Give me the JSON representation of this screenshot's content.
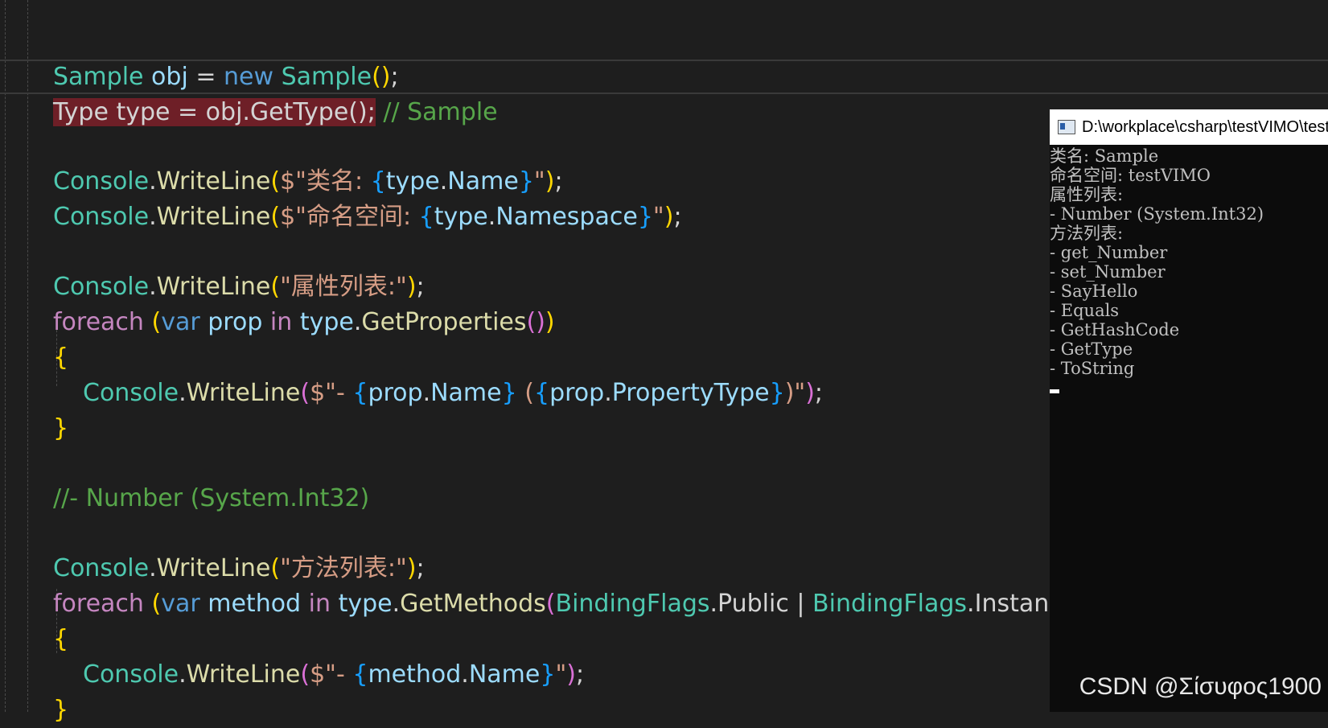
{
  "editor": {
    "code": {
      "l1": {
        "a": "Sample",
        "b": " ",
        "c": "obj",
        "d": " = ",
        "e": "new",
        "f": " ",
        "g": "Sample",
        "h": "(",
        "i": ")",
        "j": ";"
      },
      "l2": {
        "a": "Type",
        "b": " type = obj.GetType();",
        "c": " ",
        "d": "// Sample"
      },
      "l3": {
        "a": "Console",
        "b": ".",
        "c": "WriteLine",
        "d": "(",
        "e": "$\"类名: ",
        "f": "{",
        "g": "type",
        "h": ".",
        "i": "Name",
        "j": "}",
        "k": "\"",
        "l": ")",
        "m": ";"
      },
      "l4": {
        "a": "Console",
        "b": ".",
        "c": "WriteLine",
        "d": "(",
        "e": "$\"命名空间: ",
        "f": "{",
        "g": "type",
        "h": ".",
        "i": "Namespace",
        "j": "}",
        "k": "\"",
        "l": ")",
        "m": ";"
      },
      "l5": {
        "a": "Console",
        "b": ".",
        "c": "WriteLine",
        "d": "(",
        "e": "\"属性列表:\"",
        "f": ")",
        "g": ";"
      },
      "l6": {
        "a": "foreach",
        "b": " ",
        "c": "(",
        "d": "var",
        "e": " ",
        "f": "prop",
        "g": " ",
        "h": "in",
        "i": " ",
        "j": "type",
        "k": ".",
        "l": "GetProperties",
        "m": "()",
        "n": ")"
      },
      "l7": {
        "a": "{"
      },
      "l8": {
        "a": "Console",
        "b": ".",
        "c": "WriteLine",
        "d": "(",
        "e": "$\"- ",
        "f": "{",
        "g": "prop",
        "h": ".",
        "i": "Name",
        "j": "}",
        "k": " (",
        "l": "{",
        "m": "prop",
        "n": ".",
        "o": "PropertyType",
        "p": "}",
        "q": ")\"",
        "r": ")",
        "s": ";"
      },
      "l9": {
        "a": "}"
      },
      "l10": {
        "a": "//- Number (System.Int32)"
      },
      "l11": {
        "a": "Console",
        "b": ".",
        "c": "WriteLine",
        "d": "(",
        "e": "\"方法列表:\"",
        "f": ")",
        "g": ";"
      },
      "l12": {
        "a": "foreach",
        "b": " ",
        "c": "(",
        "d": "var",
        "e": " ",
        "f": "method",
        "g": " ",
        "h": "in",
        "i": " ",
        "j": "type",
        "k": ".",
        "l": "GetMethods",
        "m": "(",
        "n": "BindingFlags",
        "o": ".",
        "p": "Public",
        "q": " | ",
        "r": "BindingFlags",
        "s": ".",
        "t": "Instanc"
      },
      "l13": {
        "a": "{"
      },
      "l14": {
        "a": "Console",
        "b": ".",
        "c": "WriteLine",
        "d": "(",
        "e": "$\"- ",
        "f": "{",
        "g": "method",
        "h": ".",
        "i": "Name",
        "j": "}",
        "k": "\"",
        "l": ")",
        "m": ";"
      },
      "l15": {
        "a": "}"
      }
    }
  },
  "console": {
    "title": "D:\\workplace\\csharp\\testVIMO\\test",
    "lines": [
      "类名: Sample",
      "命名空间: testVIMO",
      "属性列表:",
      "- Number (System.Int32)",
      "方法列表:",
      "- get_Number",
      "- set_Number",
      "- SayHello",
      "- Equals",
      "- GetHashCode",
      "- GetType",
      "- ToString"
    ]
  },
  "watermark": "CSDN @Σίσυφος1900"
}
